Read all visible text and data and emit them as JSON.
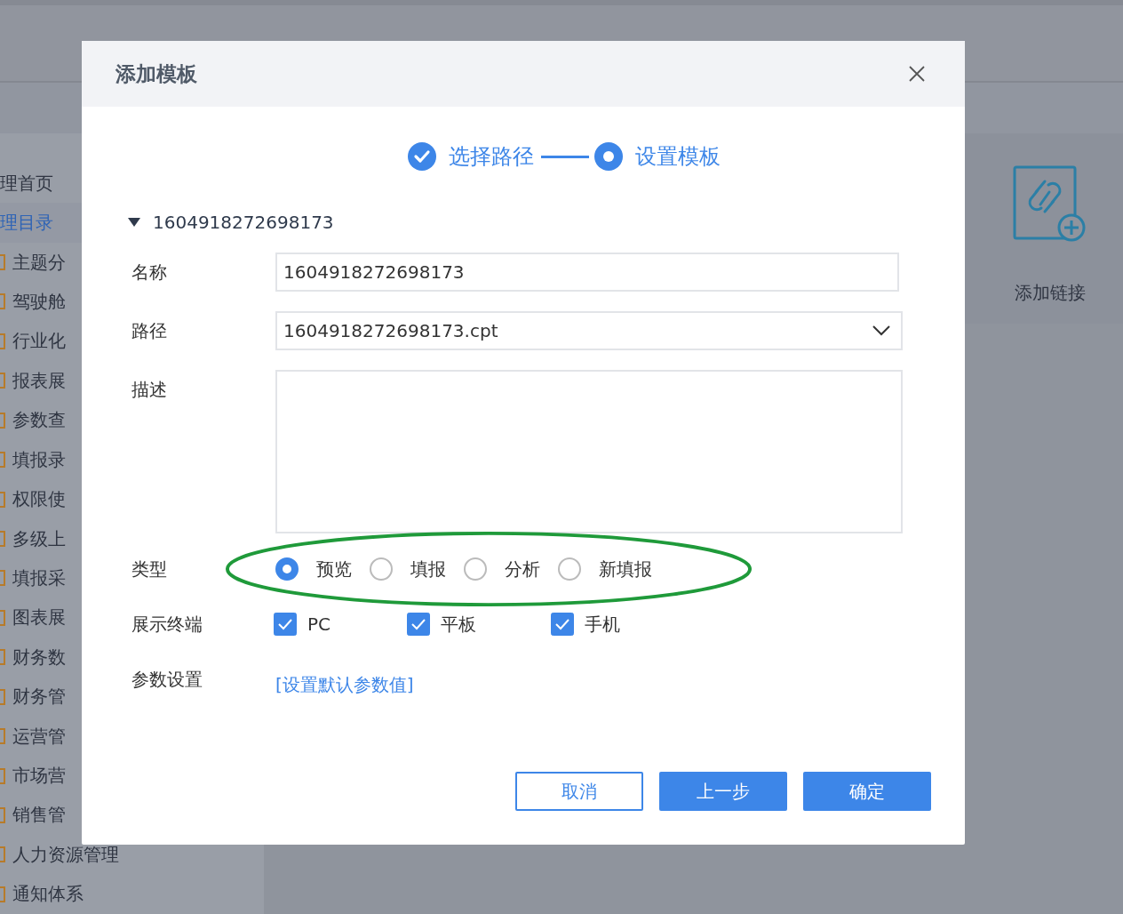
{
  "sidebar": {
    "items": [
      {
        "label": "理首页",
        "kind": "plain",
        "selected": false
      },
      {
        "label": "理目录",
        "kind": "plain",
        "selected": true
      },
      {
        "label": "主题分",
        "kind": "folder",
        "selected": false
      },
      {
        "label": "驾驶舱",
        "kind": "folder",
        "selected": false
      },
      {
        "label": "行业化",
        "kind": "folder",
        "selected": false
      },
      {
        "label": "报表展",
        "kind": "folder",
        "selected": false
      },
      {
        "label": "参数查",
        "kind": "folder",
        "selected": false
      },
      {
        "label": "填报录",
        "kind": "folder",
        "selected": false
      },
      {
        "label": "权限使",
        "kind": "folder",
        "selected": false
      },
      {
        "label": "多级上",
        "kind": "folder",
        "selected": false
      },
      {
        "label": "填报采",
        "kind": "folder",
        "selected": false
      },
      {
        "label": "图表展",
        "kind": "folder",
        "selected": false
      },
      {
        "label": "财务数",
        "kind": "folder",
        "selected": false
      },
      {
        "label": "财务管",
        "kind": "folder",
        "selected": false
      },
      {
        "label": "运营管",
        "kind": "folder",
        "selected": false
      },
      {
        "label": "市场营",
        "kind": "folder",
        "selected": false
      },
      {
        "label": "销售管",
        "kind": "folder",
        "selected": false
      },
      {
        "label": "人力资源管理",
        "kind": "folder",
        "selected": false
      },
      {
        "label": "通知体系",
        "kind": "folder",
        "selected": false
      }
    ]
  },
  "side_panel": {
    "action": "添加链接"
  },
  "dialog": {
    "title": "添加模板",
    "steps": [
      {
        "label": "选择路径",
        "completed": true
      },
      {
        "label": "设置模板",
        "completed": false
      }
    ],
    "tree_node": {
      "label": "1604918272698173",
      "expanded": true
    },
    "fields": [
      {
        "label": "名称",
        "kind": "text",
        "value": "1604918272698173"
      },
      {
        "label": "路径",
        "kind": "select",
        "value": "1604918272698173.cpt"
      },
      {
        "label": "描述",
        "kind": "textarea"
      }
    ],
    "type": {
      "label": "类型",
      "highlighted": true,
      "options": [
        {
          "label": "预览",
          "selected": true
        },
        {
          "label": "填报",
          "selected": false
        },
        {
          "label": "分析",
          "selected": false
        },
        {
          "label": "新填报",
          "selected": false
        }
      ]
    },
    "terminals": {
      "label": "展示终端",
      "options": [
        {
          "label": "PC",
          "checked": true
        },
        {
          "label": "平板",
          "checked": true
        },
        {
          "label": "手机",
          "checked": true
        }
      ]
    },
    "params": {
      "label": "参数设置",
      "link": "[设置默认参数值]"
    },
    "buttons": [
      {
        "label": "取消",
        "kind": "secondary"
      },
      {
        "label": "上一步",
        "kind": "primary"
      },
      {
        "label": "确定",
        "kind": "primary"
      }
    ]
  }
}
